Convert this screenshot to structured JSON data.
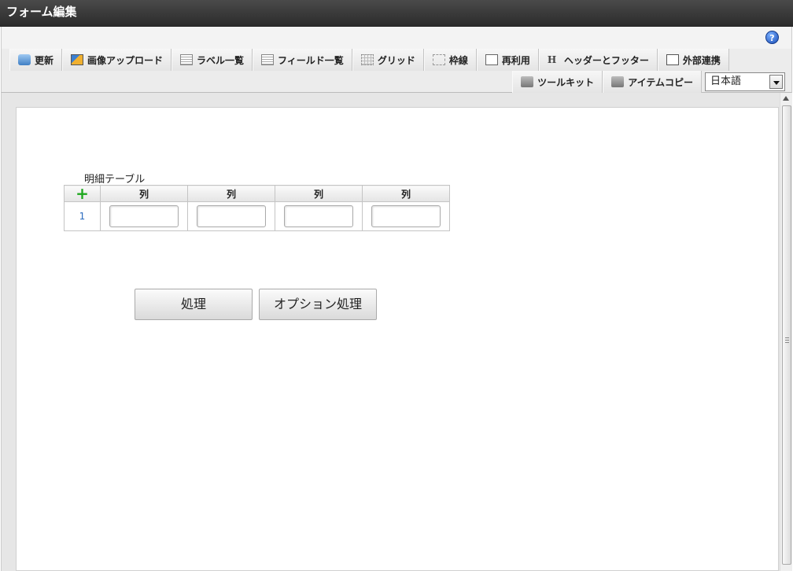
{
  "window": {
    "title": "フォーム編集"
  },
  "help": {
    "glyph": "?"
  },
  "toolbar": {
    "row1": [
      {
        "label": "更新",
        "icon": "refresh-icon"
      },
      {
        "label": "画像アップロード",
        "icon": "image-upload-icon"
      },
      {
        "label": "ラベル一覧",
        "icon": "list-icon"
      },
      {
        "label": "フィールド一覧",
        "icon": "list-icon"
      },
      {
        "label": "グリッド",
        "icon": "grid-icon"
      },
      {
        "label": "枠線",
        "icon": "frame-icon"
      },
      {
        "label": "再利用",
        "icon": "copy-icon"
      },
      {
        "label": "ヘッダーとフッター",
        "icon": "header-icon",
        "glyph": "H"
      },
      {
        "label": "外部連携",
        "icon": "external-link-icon"
      }
    ],
    "row2": [
      {
        "label": "ツールキット",
        "icon": "toolkit-icon"
      },
      {
        "label": "アイテムコピー",
        "icon": "toolkit-icon"
      }
    ],
    "language": {
      "selected": "日本語"
    }
  },
  "canvas": {
    "table": {
      "caption": "明細テーブル",
      "add_glyph": "+",
      "columns": [
        "列",
        "列",
        "列",
        "列"
      ],
      "rows": [
        {
          "number": "1"
        }
      ]
    },
    "buttons": {
      "process": "処理",
      "option_process": "オプション処理"
    }
  }
}
